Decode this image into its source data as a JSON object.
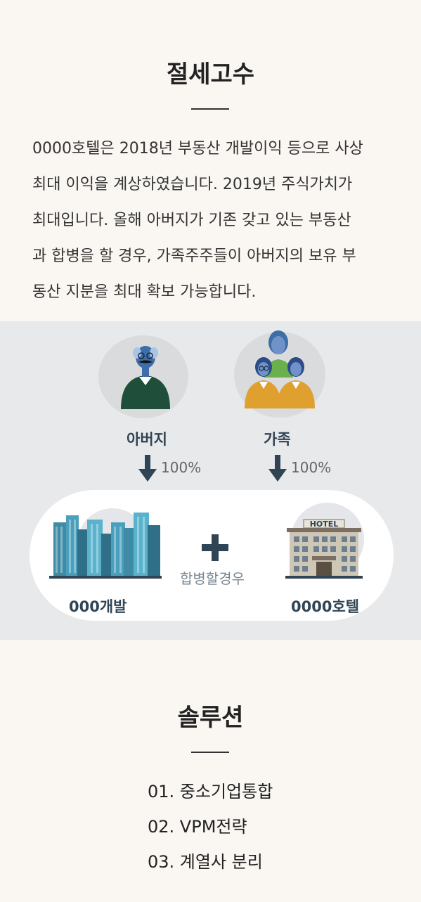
{
  "section1": {
    "title": "절세고수",
    "paragraph_lines": [
      "0000호텔은 2018년 부동산 개발이익 등으로 사상",
      "최대 이익을 계상하였습니다. 2019년 주식가치가",
      "최대입니다. 올해 아버지가 기존 갖고 있는  부동산",
      "과 합병을 할 경우, 가족주주들이 아버지의 보유 부",
      "동산 지분을 최대 확보 가능합니다."
    ]
  },
  "diagram": {
    "father": {
      "label": "아버지",
      "share": "100%",
      "icon": "father-icon"
    },
    "family": {
      "label": "가족",
      "share": "100%",
      "icon": "family-icon"
    },
    "company_a": {
      "label": "000개발",
      "icon": "skyscrapers-icon"
    },
    "company_b": {
      "label": "0000호텔",
      "icon": "hotel-icon",
      "sign": "HOTEL"
    },
    "merge_text": "합병할경우",
    "colors": {
      "navy": "#2f4454",
      "green": "#1f4f3a",
      "gold": "#e0a030",
      "blue": "#3d6ea8"
    }
  },
  "section3": {
    "title": "솔루션",
    "items": [
      "01.  중소기업통합",
      "02.  VPM전략",
      "03.  계열사 분리"
    ]
  }
}
